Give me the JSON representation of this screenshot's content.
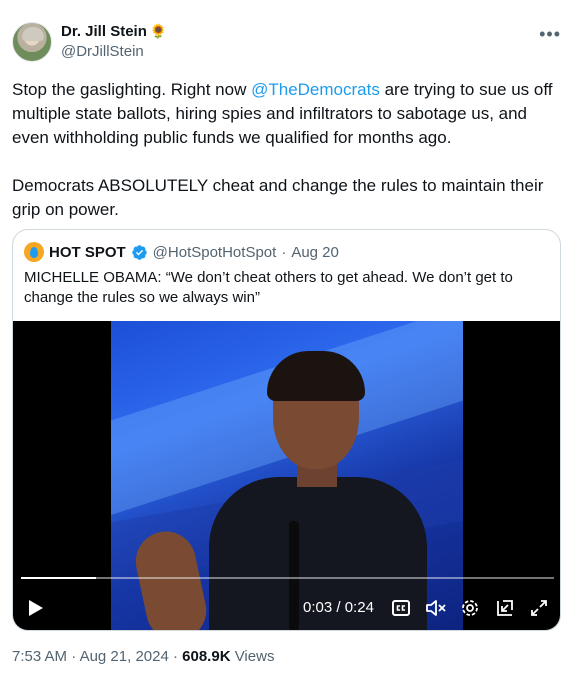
{
  "author": {
    "name": "Dr. Jill Stein",
    "emoji": "🌻",
    "handle": "@DrJillStein"
  },
  "more_label": "•••",
  "tweet": {
    "para1_before": "Stop the gaslighting. Right now ",
    "mention": "@TheDemocrats",
    "para1_after": " are trying to sue us off multiple state ballots, hiring spies and infiltrators to sabotage us, and even withholding public funds we qualified for months ago.",
    "para2": "Democrats ABSOLUTELY cheat and change the rules to maintain their grip on power."
  },
  "quote": {
    "name": "HOT SPOT",
    "handle": "@HotSpotHotSpot",
    "separator": "·",
    "date": "Aug 20",
    "text": "MICHELLE OBAMA: “We don’t cheat others to get ahead. We don’t get to change the rules so we always win”"
  },
  "video": {
    "current_time": "0:03",
    "duration": "0:24",
    "time_separator": " / ",
    "progress": 0.14
  },
  "footer": {
    "time": "7:53 AM",
    "date": "Aug 21, 2024",
    "dot": "·",
    "views_count": "608.9K",
    "views_label": "Views"
  },
  "colors": {
    "accent": "#1d9bf0",
    "muted": "#536471",
    "text": "#0f1419",
    "border": "#cfd9de"
  }
}
